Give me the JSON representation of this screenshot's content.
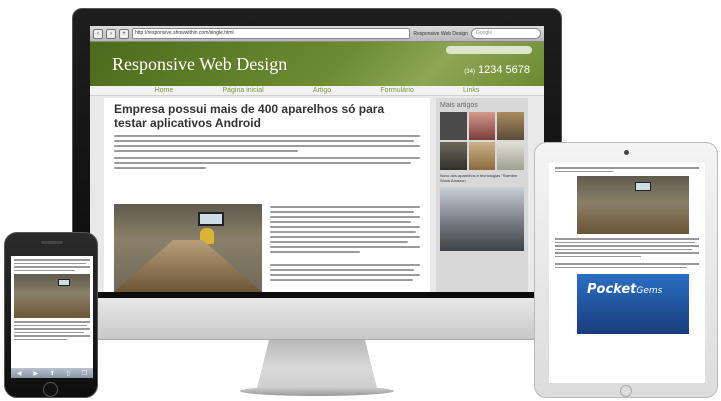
{
  "browser": {
    "url": "http://responsive.showwithin.com/single.html",
    "tab_title": "Responsive Web Design",
    "search_placeholder": "Google"
  },
  "site": {
    "title": "Responsive Web Design",
    "phone_prefix": "(34)",
    "phone": "1234 5678",
    "nav": [
      "Home",
      "Página inicial",
      "Artigo",
      "Formulário",
      "Links"
    ]
  },
  "article": {
    "title": "Empresa possui mais de 400 aparelhos só para testar aplicativos Android"
  },
  "sidebar": {
    "title": "Mais artigos",
    "caption": "Novo dos aparelhos e tecnologias \"Sweden Show Amazon"
  },
  "ipad": {
    "banner_word1": "Pocket",
    "banner_word2": "Gems"
  },
  "colors": {
    "header_green": "#6d8c32",
    "nav_link": "#7a9a3a"
  }
}
